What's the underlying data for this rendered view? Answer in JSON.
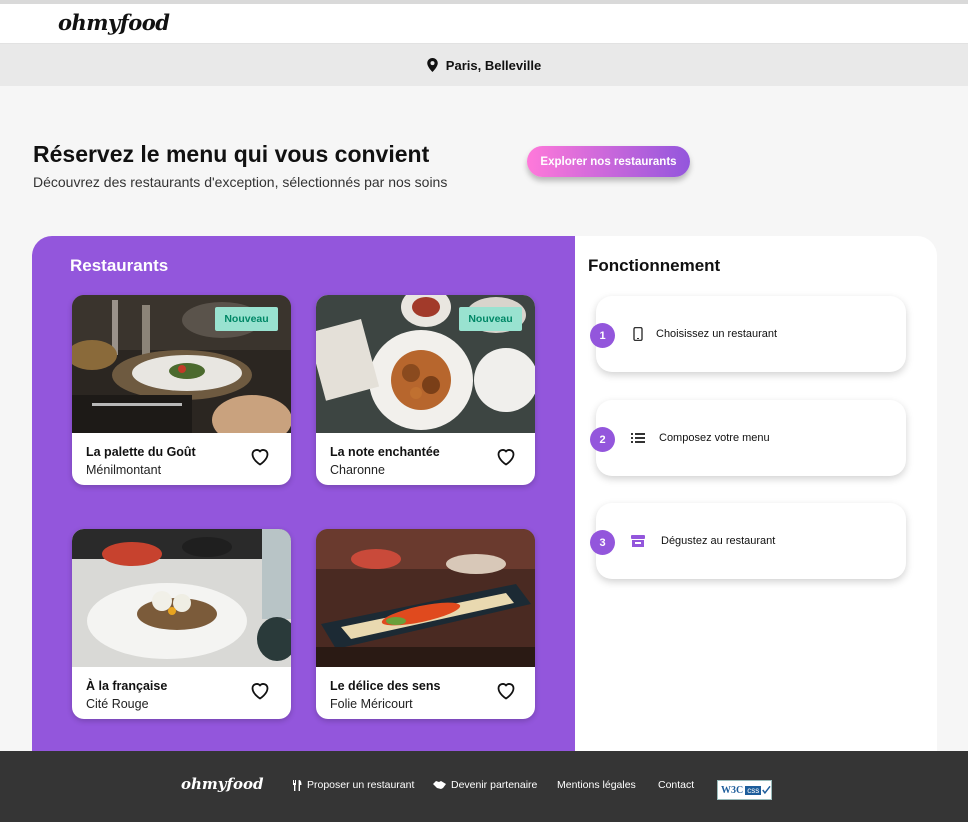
{
  "header": {
    "logo": "ohmyfood"
  },
  "location": {
    "icon": "map-pin-icon",
    "text": "Paris, Belleville"
  },
  "hero": {
    "title": "Réservez le menu qui vous convient",
    "subtitle": "Découvrez des restaurants d'exception, sélectionnés par nos soins",
    "cta_label": "Explorer nos restaurants"
  },
  "restaurants": {
    "title": "Restaurants",
    "items": [
      {
        "name": "La palette du Goût",
        "area": "Ménilmontant",
        "badge": "Nouveau"
      },
      {
        "name": "La note enchantée",
        "area": "Charonne",
        "badge": "Nouveau"
      },
      {
        "name": "À la française",
        "area": "Cité Rouge",
        "badge": ""
      },
      {
        "name": "Le délice des sens",
        "area": "Folie Méricourt",
        "badge": ""
      }
    ]
  },
  "how": {
    "title": "Fonctionnement",
    "steps": [
      {
        "number": "1",
        "icon": "mobile-phone-icon",
        "label": "Choisissez un restaurant"
      },
      {
        "number": "2",
        "icon": "list-icon",
        "label": "Composez votre menu"
      },
      {
        "number": "3",
        "icon": "store-icon",
        "label": "Dégustez au restaurant"
      }
    ]
  },
  "footer": {
    "logo": "ohmyfood",
    "links": [
      {
        "icon": "utensils-icon",
        "label": "Proposer un restaurant"
      },
      {
        "icon": "handshake-icon",
        "label": "Devenir partenaire"
      },
      {
        "icon": "",
        "label": "Mentions légales"
      },
      {
        "icon": "",
        "label": "Contact"
      }
    ],
    "badge": {
      "left": "W3C",
      "right": "css"
    }
  },
  "colors": {
    "primary": "#9356dc",
    "accent_pink": "#ff79da",
    "badge_bg": "#99e2d0",
    "badge_text": "#008766",
    "footer_bg": "#353535"
  }
}
